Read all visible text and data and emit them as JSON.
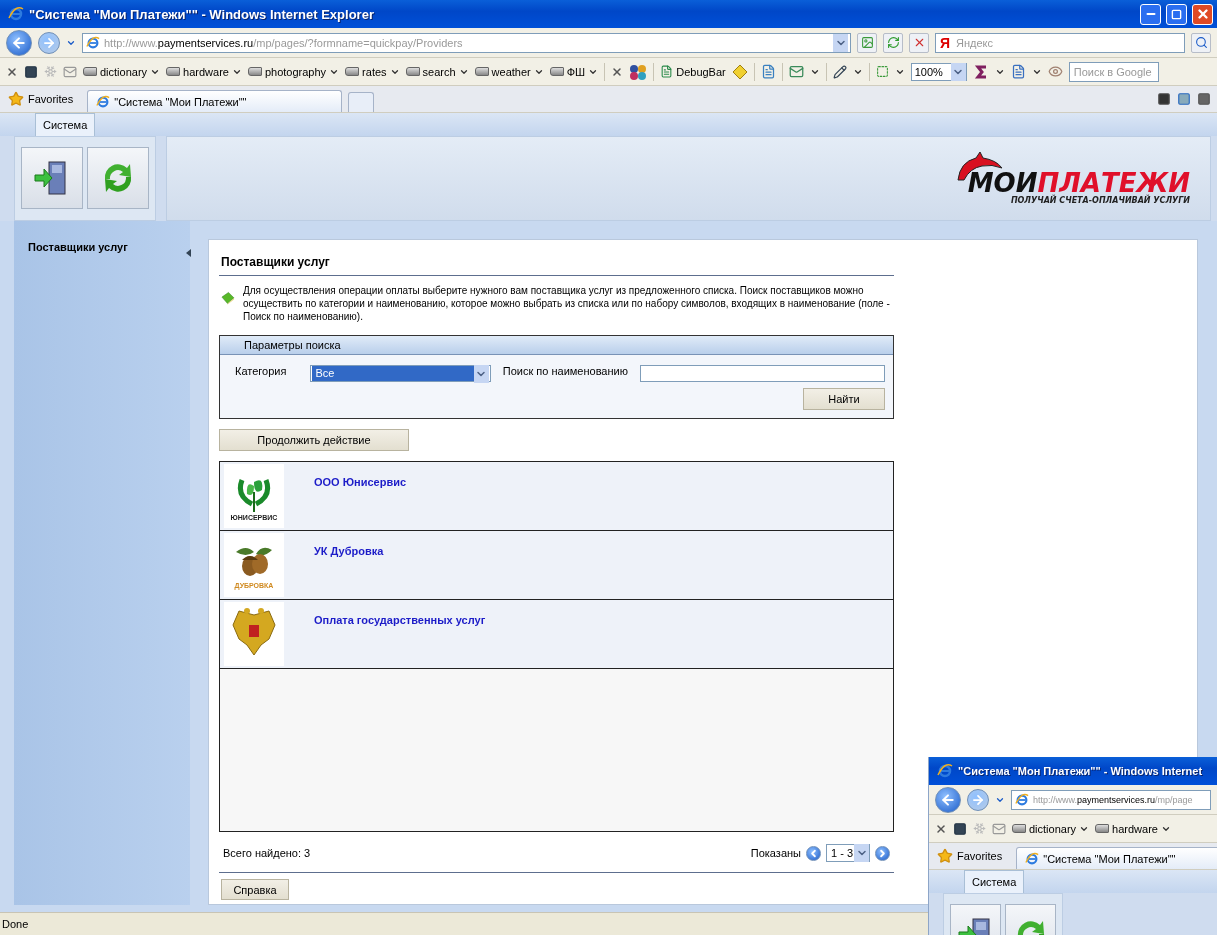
{
  "browser": {
    "title": "\"Система \"Мои Платежи\"\" - Windows Internet Explorer",
    "url_prefix": "http://www.",
    "url_domain": "paymentservices.ru",
    "url_path": "/mp/pages/?formname=quickpay/Providers",
    "search_logo": "Я",
    "search_placeholder": "Яндекс",
    "links": [
      "dictionary",
      "hardware",
      "photography",
      "rates",
      "search",
      "weather",
      "ФШ"
    ],
    "debugbar": "DebugBar",
    "zoom": "100%",
    "google_placeholder": "Поиск в Google",
    "favorites": "Favorites",
    "tabs": [
      {
        "label": "\"Система \"Мои Платежи\"\"",
        "selected": true
      }
    ]
  },
  "app": {
    "menu_tabs": [
      {
        "label": "Система",
        "selected": true
      }
    ],
    "logo": {
      "main": "МОИ",
      "accent": "ПЛАТЕЖИ",
      "slogan": "ПОЛУЧАЙ СЧЕТА-ОПЛАЧИВАЙ УСЛУГИ"
    },
    "sidebar": {
      "items": [
        "Поставщики услуг"
      ]
    },
    "panel": {
      "title": "Поставщики услуг",
      "description": "Для осуществления операции оплаты выберите нужного вам поставщика услуг из предложенного списка. Поиск поставщиков можно осуществить по категории и наименованию, которое можно выбрать из списка или по набору символов, входящих в наименование (поле - Поиск по наименованию).",
      "search": {
        "header": "Параметры поиска",
        "category_label": "Категория",
        "category_value": "Все",
        "name_label": "Поиск по наименованию",
        "find_button": "Найти"
      },
      "continue_button": "Продолжить действие",
      "providers": [
        {
          "name": "ООО Юнисервис",
          "kind": "leaf",
          "logo_text": "ЮНИСЕРВИС"
        },
        {
          "name": "УК Дубровка",
          "kind": "acorn",
          "logo_text": "ДУБРОВКА"
        },
        {
          "name": "Оплата государственных услуг",
          "kind": "emblem"
        }
      ],
      "total": "Всего найдено: 3",
      "shown_label": "Показаны",
      "page_value": "1 - 3",
      "help_button": "Справка"
    }
  },
  "status_bar": {
    "text": "Done"
  },
  "overlay_window": {
    "title": "\"Система \"Мон Платежи\"\" - Windows Internet",
    "url_prefix": "http://www.",
    "url_domain": "paymentservices.ru",
    "url_path": "/mp/page",
    "links": [
      "dictionary",
      "hardware"
    ],
    "favorites": "Favorites",
    "tabs": [
      {
        "label": "\"Система \"Мои Платежи\"\"",
        "selected": true
      }
    ],
    "menu_tabs": [
      {
        "label": "Система",
        "selected": true
      }
    ]
  }
}
